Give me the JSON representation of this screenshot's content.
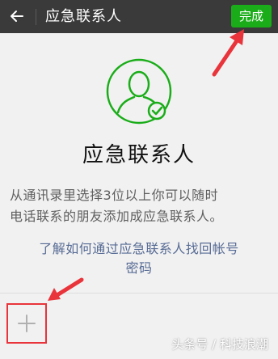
{
  "header": {
    "title": "应急联系人",
    "done_label": "完成"
  },
  "main": {
    "heading": "应急联系人",
    "description_lines": [
      "从通讯录里选择3位以上你可以随时",
      "电话联系的朋友添加成应急联系人。"
    ],
    "help_link_lines": [
      "了解如何通过应急联系人找回帐号",
      "密码"
    ]
  },
  "watermark": "头条号 / 科技浪潮",
  "icons": [
    "back-arrow-icon",
    "avatar-check-icon",
    "plus-icon"
  ],
  "colors": {
    "topbar": "#3a3a3a",
    "accent_green": "#1aad19",
    "link_blue": "#576b95",
    "annotation_red": "#e8343a"
  }
}
